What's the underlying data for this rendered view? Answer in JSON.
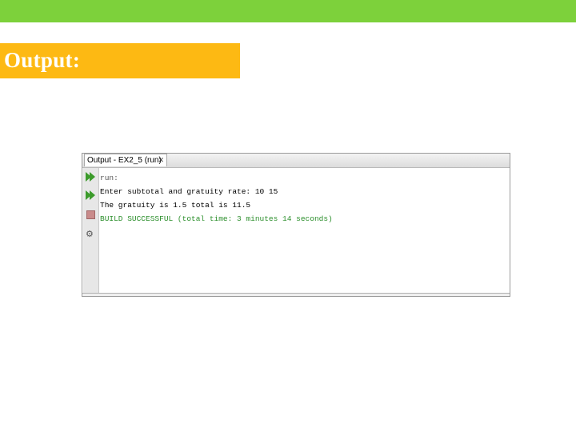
{
  "slide": {
    "heading": "Output:",
    "colors": {
      "top_bar": "#7dd13b",
      "heading_bg": "#fdb913",
      "heading_text": "#ffffff"
    }
  },
  "output_window": {
    "tab_title": "Output - EX2_5 (run)",
    "tab_close_icon": "close-icon",
    "sidebar_icons": [
      "rerun-icon",
      "rerun-with-options-icon",
      "stop-icon",
      "output-options-icon"
    ],
    "lines": [
      {
        "text": "run:",
        "style": "gray"
      },
      {
        "text": "Enter subtotal and gratuity rate: 10 15",
        "style": "normal"
      },
      {
        "text": "The gratuity is 1.5 total is 11.5",
        "style": "normal"
      },
      {
        "text": "BUILD SUCCESSFUL (total time: 3 minutes 14 seconds)",
        "style": "green"
      }
    ]
  }
}
